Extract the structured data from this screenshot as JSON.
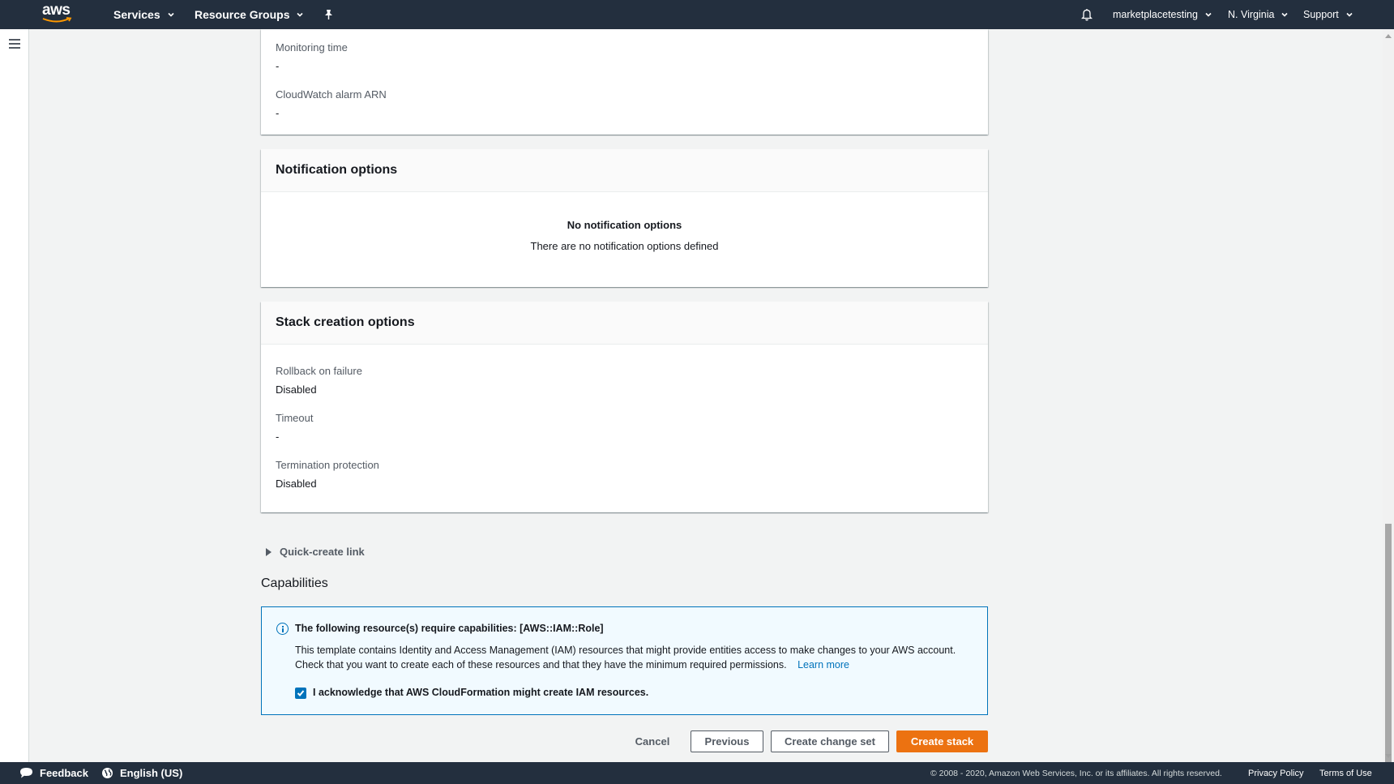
{
  "topnav": {
    "logo_text": "aws",
    "services_label": "Services",
    "resource_groups_label": "Resource Groups",
    "account_label": "marketplacetesting",
    "region_label": "N. Virginia",
    "support_label": "Support"
  },
  "monitoring_panel": {
    "monitoring_time_label": "Monitoring time",
    "monitoring_time_value": "-",
    "alarm_arn_label": "CloudWatch alarm ARN",
    "alarm_arn_value": "-"
  },
  "notification_panel": {
    "title": "Notification options",
    "empty_title": "No notification options",
    "empty_desc": "There are no notification options defined"
  },
  "stack_panel": {
    "title": "Stack creation options",
    "rollback_label": "Rollback on failure",
    "rollback_value": "Disabled",
    "timeout_label": "Timeout",
    "timeout_value": "-",
    "termination_label": "Termination protection",
    "termination_value": "Disabled"
  },
  "quick_create_label": "Quick-create link",
  "capabilities": {
    "heading": "Capabilities",
    "info_title": "The following resource(s) require capabilities: [AWS::IAM::Role]",
    "info_text": "This template contains Identity and Access Management (IAM) resources that might provide entities access to make changes to your AWS account. Check that you want to create each of these resources and that they have the minimum required permissions.",
    "learn_more": "Learn more",
    "acknowledge_label": "I acknowledge that AWS CloudFormation might create IAM resources."
  },
  "actions": {
    "cancel": "Cancel",
    "previous": "Previous",
    "create_change_set": "Create change set",
    "create_stack": "Create stack"
  },
  "footer": {
    "feedback": "Feedback",
    "language": "English (US)",
    "copyright": "© 2008 - 2020, Amazon Web Services, Inc. or its affiliates. All rights reserved.",
    "privacy": "Privacy Policy",
    "terms": "Terms of Use"
  },
  "colors": {
    "nav_bg": "#232f3e",
    "primary": "#ec7211",
    "info_blue": "#0073bb"
  }
}
